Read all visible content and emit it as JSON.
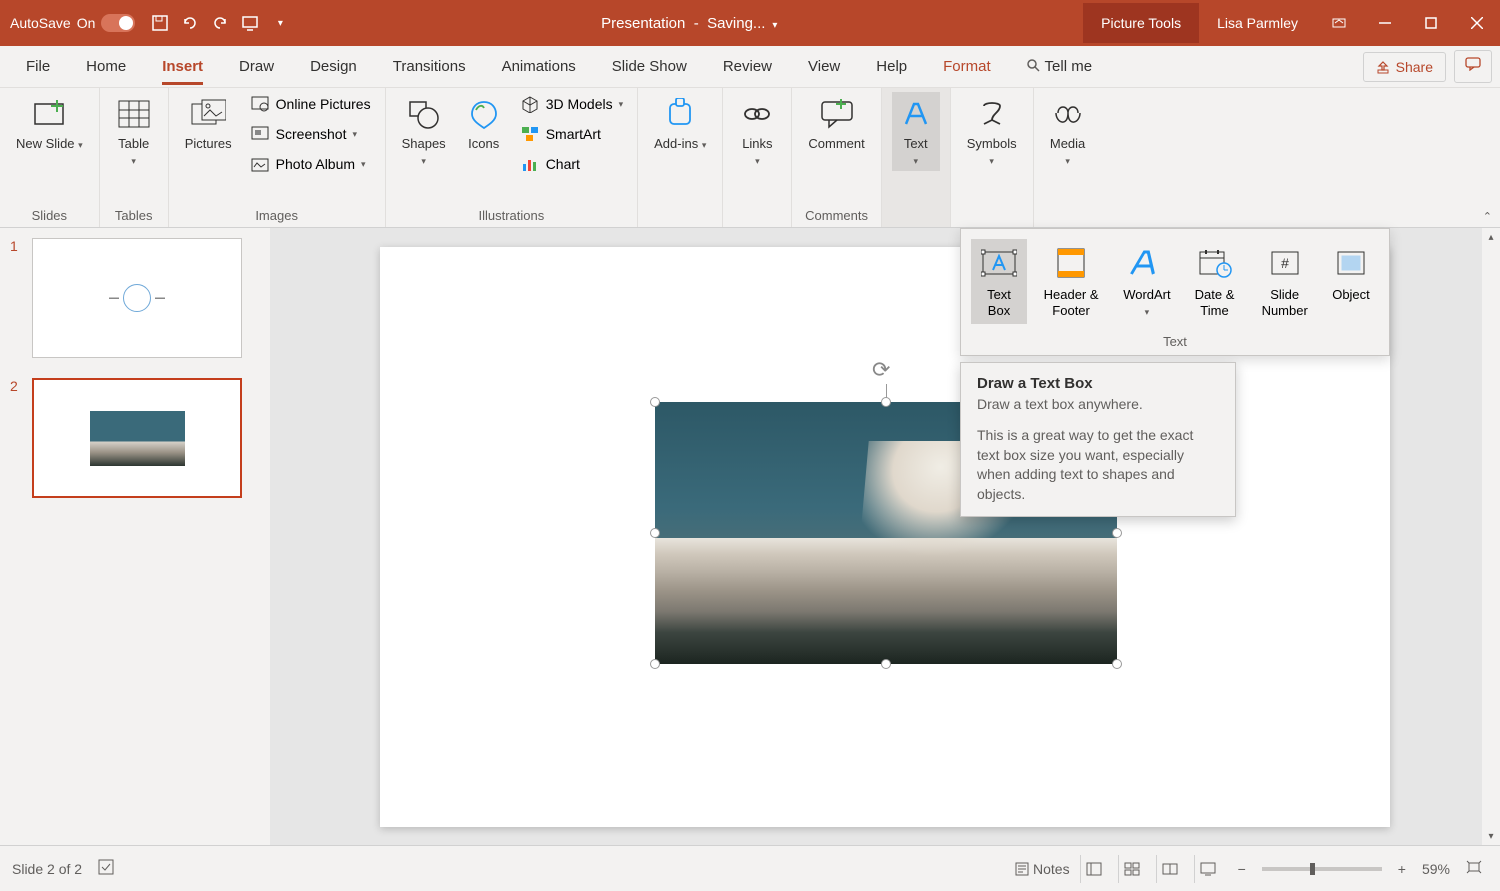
{
  "titleBar": {
    "autoSaveLabel": "AutoSave",
    "autoSaveState": "On",
    "titleLeft": "Presentation",
    "titleSep": "-",
    "titleStatus": "Saving...",
    "pictureTools": "Picture Tools",
    "userName": "Lisa Parmley"
  },
  "tabs": {
    "file": "File",
    "home": "Home",
    "insert": "Insert",
    "draw": "Draw",
    "design": "Design",
    "transitions": "Transitions",
    "animations": "Animations",
    "slideShow": "Slide Show",
    "review": "Review",
    "view": "View",
    "help": "Help",
    "format": "Format",
    "tellMe": "Tell me",
    "share": "Share"
  },
  "ribbon": {
    "newSlide": "New Slide",
    "slidesGroup": "Slides",
    "table": "Table",
    "tablesGroup": "Tables",
    "pictures": "Pictures",
    "onlinePictures": "Online Pictures",
    "screenshot": "Screenshot",
    "photoAlbum": "Photo Album",
    "imagesGroup": "Images",
    "shapes": "Shapes",
    "icons": "Icons",
    "models3d": "3D Models",
    "smartArt": "SmartArt",
    "chart": "Chart",
    "illustrationsGroup": "Illustrations",
    "addIns": "Add-ins",
    "links": "Links",
    "comment": "Comment",
    "commentsGroup": "Comments",
    "text": "Text",
    "symbols": "Symbols",
    "media": "Media"
  },
  "textDropdown": {
    "textBox": "Text Box",
    "headerFooter": "Header & Footer",
    "wordArt": "WordArt",
    "dateTime": "Date & Time",
    "slideNumber": "Slide Number",
    "object": "Object",
    "groupLabel": "Text"
  },
  "tooltip": {
    "title": "Draw a Text Box",
    "subtitle": "Draw a text box anywhere.",
    "body": "This is a great way to get the exact text box size you want, especially when adding text to shapes and objects."
  },
  "slidePanel": {
    "slides": [
      {
        "num": "1"
      },
      {
        "num": "2"
      }
    ]
  },
  "statusBar": {
    "slideInfo": "Slide 2 of 2",
    "notes": "Notes",
    "zoom": "59%"
  }
}
